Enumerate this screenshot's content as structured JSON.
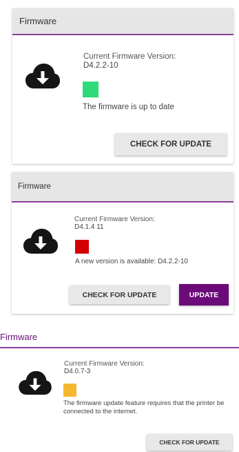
{
  "panels": [
    {
      "header": "Firmware",
      "version_label": "Current Firmware Version:",
      "version_value": "D4.2.2-10",
      "status_color": "#2ddc78",
      "status_text": "The firmware is up to date",
      "check_button": "CHECK FOR UPDATE",
      "icon": "cloud-download-icon"
    },
    {
      "header": "Firmware",
      "version_label": "Current Firmware Version:",
      "version_value": "D4.1.4 11",
      "status_color": "#d40000",
      "status_text": "A new version is available: D4.2.2-10",
      "check_button": "CHECK FOR UPDATE",
      "update_button": "UPDATE",
      "icon": "cloud-download-icon"
    },
    {
      "header": "Firmware",
      "version_label": "Current Firmware Version:",
      "version_value": "D4.0.7-3",
      "status_color": "#f5b82e",
      "status_text": "The firmware update feature requires that the printer be connected to the internet.",
      "check_button": "CHECK FOR UPDATE",
      "icon": "cloud-download-icon"
    }
  ],
  "colors": {
    "accent_purple": "#6c0a7a",
    "header_gray": "#e6e6e6"
  }
}
